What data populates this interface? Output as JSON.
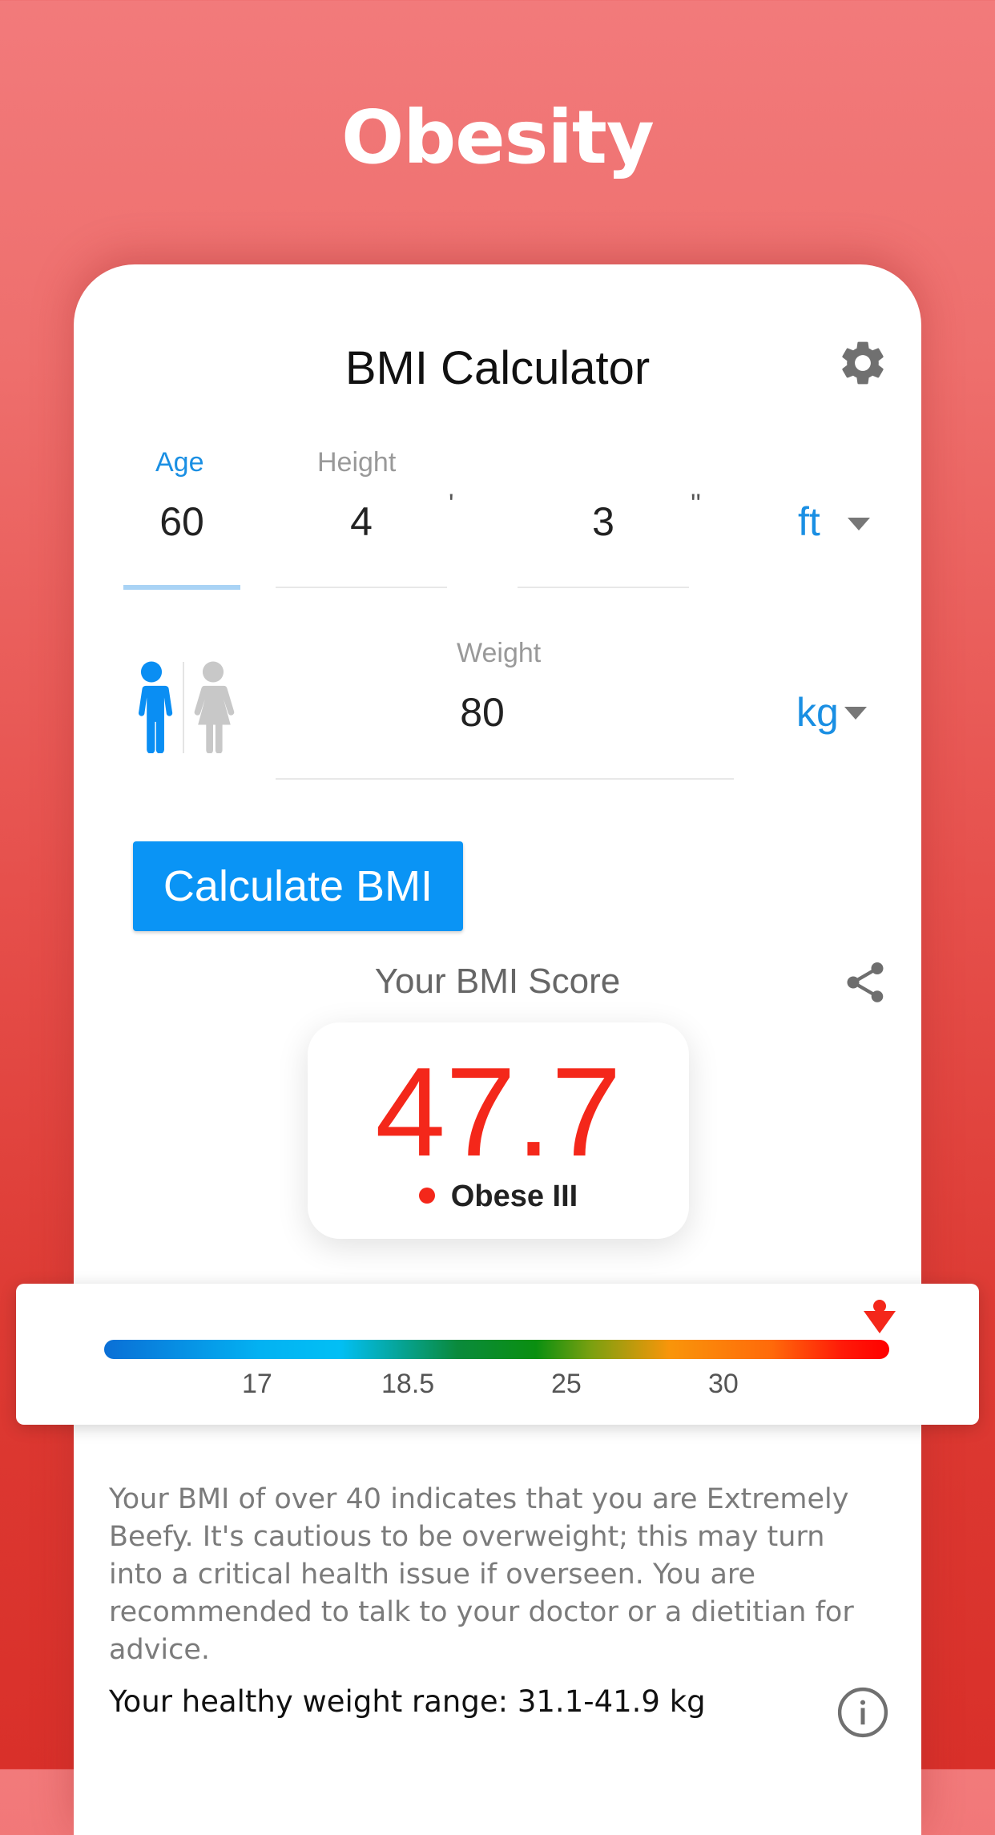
{
  "headline": "Obesity",
  "app": {
    "title": "BMI Calculator",
    "age": {
      "label": "Age",
      "value": "60"
    },
    "height": {
      "label": "Height",
      "feet": "4",
      "feet_mark": "'",
      "inches": "3",
      "inches_mark": "''",
      "unit": "ft"
    },
    "weight": {
      "label": "Weight",
      "value": "80",
      "unit": "kg"
    },
    "gender": {
      "selected": "male",
      "options": [
        "male",
        "female"
      ]
    },
    "calculate_label": "Calculate BMI",
    "score_label": "Your BMI Score",
    "score": "47.7",
    "category": "Obese III",
    "scale": {
      "ticks": [
        "17",
        "18.5",
        "25",
        "30"
      ],
      "marker_position": 1.0
    },
    "advice": "Your BMI of over 40 indicates that you are Extremely Beefy. It's cautious to be overweight; this may turn into a critical health issue if overseen. You are recommended to talk to your doctor or a dietitian for advice.",
    "healthy_range": "Your healthy weight range: 31.1-41.9 kg"
  },
  "colors": {
    "accent": "#1a8fe3",
    "button": "#0a94f5",
    "score": "#f4271a",
    "background_top": "#f27a7b",
    "background_bottom": "#d9302a"
  },
  "icons": {
    "settings": "gear-icon",
    "share": "share-icon",
    "info": "info-icon",
    "male": "male-icon",
    "female": "female-icon",
    "marker": "arrow-down-marker-icon"
  }
}
